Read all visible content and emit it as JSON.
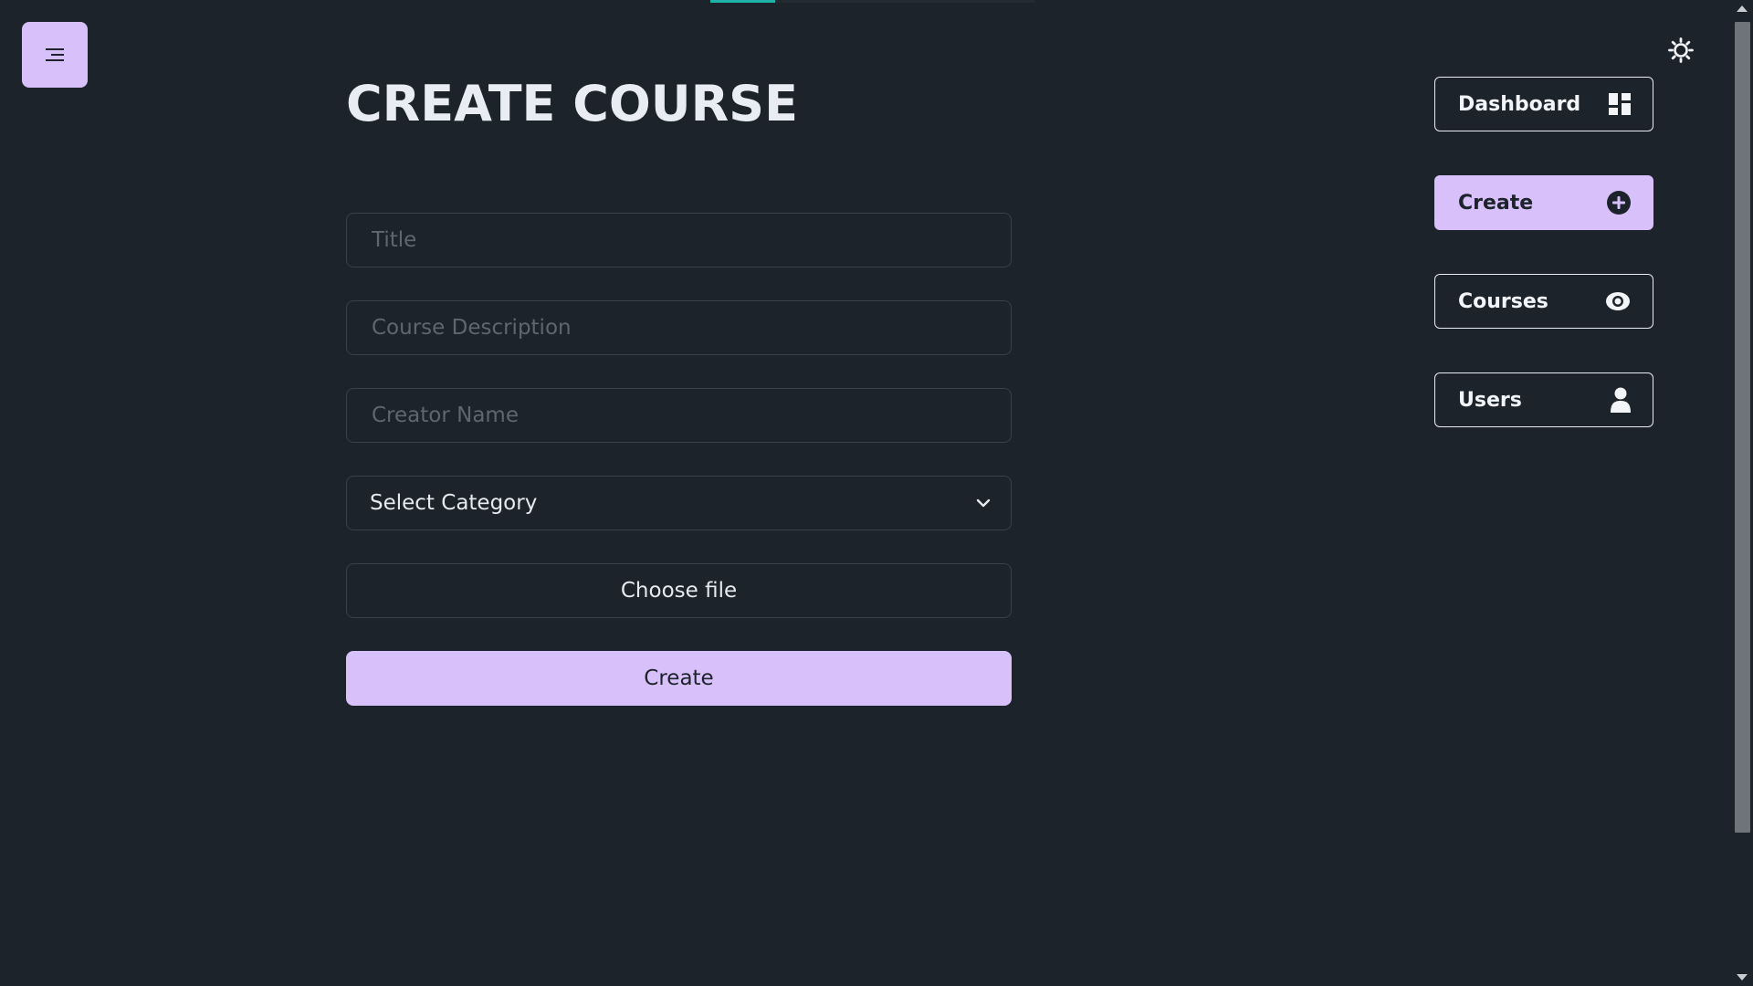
{
  "header": {
    "title": "CREATE COURSE"
  },
  "top_progress": {
    "fraction": 0.2
  },
  "menu_button": {
    "icon": "hamburger-icon"
  },
  "theme_toggle": {
    "icon": "sun-icon"
  },
  "form": {
    "title_placeholder": "Title",
    "title_value": "",
    "description_placeholder": "Course Description",
    "description_value": "",
    "creator_placeholder": "Creator Name",
    "creator_value": "",
    "category_selected": "Select Category",
    "file_label": "Choose file",
    "submit_label": "Create"
  },
  "nav": {
    "items": [
      {
        "label": "Dashboard",
        "icon": "dashboard-icon",
        "active": false
      },
      {
        "label": "Create",
        "icon": "plus-circle-icon",
        "active": true
      },
      {
        "label": "Courses",
        "icon": "eye-icon",
        "active": false
      },
      {
        "label": "Users",
        "icon": "user-icon",
        "active": false
      }
    ]
  },
  "colors": {
    "background": "#1d232a",
    "accent": "#d8c0fa",
    "progress": "#1fb2a6",
    "text": "#e9edf3",
    "field_border": "#3a4049"
  }
}
